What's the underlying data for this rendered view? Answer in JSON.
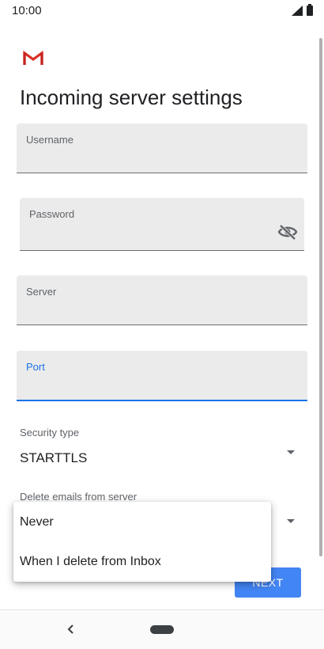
{
  "status_bar": {
    "time": "10:00",
    "icons": [
      "signal-icon",
      "battery-icon"
    ]
  },
  "app": {
    "logo": "gmail-logo-icon",
    "accent_color": "#1a73e8",
    "button_color": "#4285f4"
  },
  "page": {
    "title": "Incoming server settings"
  },
  "form": {
    "username": {
      "label": "Username",
      "value": ""
    },
    "password": {
      "label": "Password",
      "value": "",
      "icon": "visibility-off-icon"
    },
    "server": {
      "label": "Server",
      "value": ""
    },
    "port": {
      "label": "Port",
      "value": ""
    },
    "security_type": {
      "label": "Security type",
      "value": "STARTTLS"
    },
    "delete_emails": {
      "label": "Delete emails from server"
    }
  },
  "dropdown_menu": {
    "options": [
      "Never",
      "When I delete from Inbox"
    ]
  },
  "buttons": {
    "next": "Next"
  },
  "nav_bar": {
    "icons": [
      "back-icon",
      "home-pill-icon"
    ]
  }
}
